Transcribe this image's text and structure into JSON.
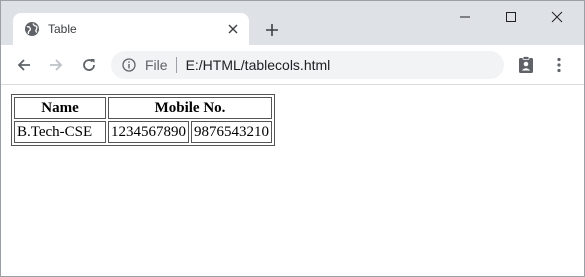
{
  "browser": {
    "tab": {
      "title": "Table"
    },
    "address": {
      "scheme_label": "File",
      "url": "E:/HTML/tablecols.html"
    }
  },
  "icons": {
    "favicon": "globe-icon",
    "tab_close": "close-icon",
    "new_tab": "plus-icon",
    "minimize": "minimize-icon",
    "maximize": "maximize-icon",
    "close": "close-icon",
    "back": "arrow-left-icon",
    "forward": "arrow-right-icon",
    "reload": "reload-icon",
    "info": "info-icon",
    "extension": "clipboard-user-icon",
    "menu": "kebab-menu-icon"
  },
  "table": {
    "headers": [
      {
        "label": "Name",
        "colspan": 1
      },
      {
        "label": "Mobile No.",
        "colspan": 2
      }
    ],
    "rows": [
      [
        "B.Tech-CSE",
        "1234567890",
        "9876543210"
      ]
    ]
  }
}
